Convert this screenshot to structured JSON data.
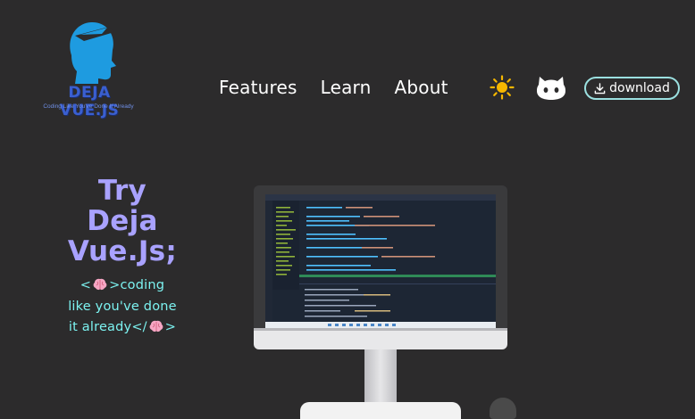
{
  "logo": {
    "title": "DEJA VUE.JS",
    "tagline": "Coding Like You've Done It Already"
  },
  "nav": {
    "items": [
      {
        "label": "Features"
      },
      {
        "label": "Learn"
      },
      {
        "label": "About"
      }
    ]
  },
  "header": {
    "theme_icon": "sun-icon",
    "github_icon": "github-icon",
    "download_label": "download"
  },
  "hero": {
    "title_lines": [
      "Try",
      "Deja",
      "Vue.Js;"
    ],
    "subtitle": {
      "line1_prefix": "<",
      "line1_suffix": ">coding",
      "line2": "like you've done",
      "line3_prefix": "it already</",
      "line3_suffix": ">"
    }
  },
  "colors": {
    "background": "#2c2b2c",
    "title": "#a9a2ff",
    "subtitle": "#7cf2f0",
    "download_border": "#9be0e0",
    "logo_blue": "#1e9be0"
  }
}
